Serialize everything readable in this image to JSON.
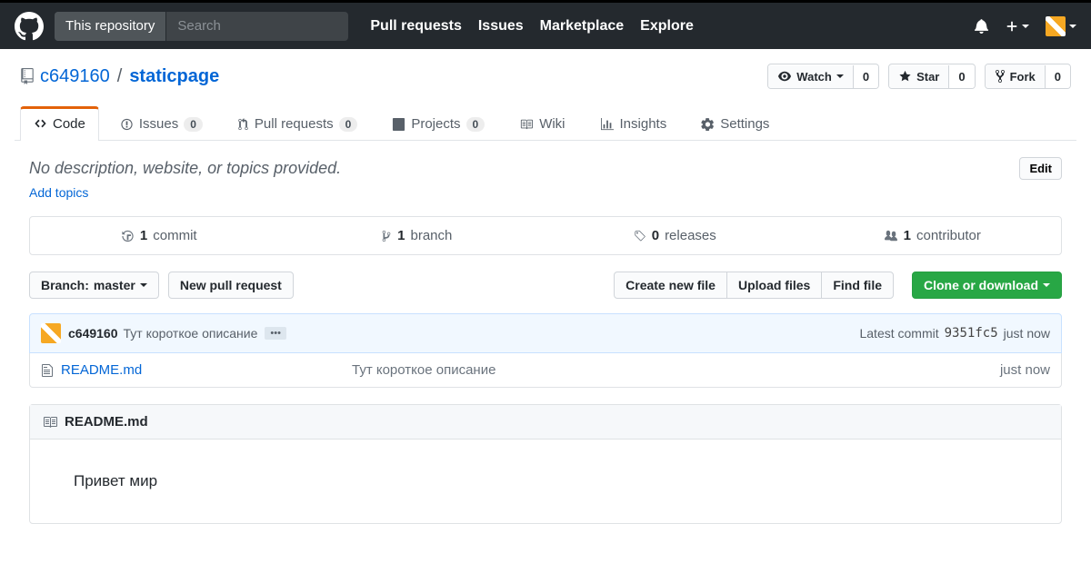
{
  "header": {
    "scope_label": "This repository",
    "search_placeholder": "Search",
    "nav": {
      "pulls": "Pull requests",
      "issues": "Issues",
      "marketplace": "Marketplace",
      "explore": "Explore"
    }
  },
  "repo": {
    "owner": "c649160",
    "name": "staticpage",
    "watch_label": "Watch",
    "watch_count": "0",
    "star_label": "Star",
    "star_count": "0",
    "fork_label": "Fork",
    "fork_count": "0"
  },
  "tabs": {
    "code": "Code",
    "issues": "Issues",
    "issues_count": "0",
    "pulls": "Pull requests",
    "pulls_count": "0",
    "projects": "Projects",
    "projects_count": "0",
    "wiki": "Wiki",
    "insights": "Insights",
    "settings": "Settings"
  },
  "description": {
    "text": "No description, website, or topics provided.",
    "edit": "Edit",
    "add_topics": "Add topics"
  },
  "stats": {
    "commits_n": "1",
    "commits_l": "commit",
    "branches_n": "1",
    "branches_l": "branch",
    "releases_n": "0",
    "releases_l": "releases",
    "contrib_n": "1",
    "contrib_l": "contributor"
  },
  "filenav": {
    "branch_prefix": "Branch:",
    "branch_name": "master",
    "new_pr": "New pull request",
    "create_file": "Create new file",
    "upload": "Upload files",
    "find": "Find file",
    "clone": "Clone or download"
  },
  "commit": {
    "author": "c649160",
    "message": "Тут короткое описание",
    "latest_prefix": "Latest commit",
    "sha": "9351fc5",
    "time": "just now"
  },
  "files": [
    {
      "name": "README.md",
      "msg": "Тут короткое описание",
      "time": "just now"
    }
  ],
  "readme": {
    "filename": "README.md",
    "content": "Привет мир"
  }
}
